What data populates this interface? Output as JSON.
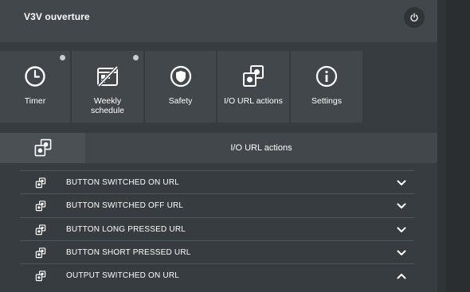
{
  "app": {
    "title": "V3V ouverture"
  },
  "tiles": [
    {
      "label": "Timer",
      "icon": "clock-icon",
      "has_dot": true
    },
    {
      "label": "Weekly\nschedule",
      "icon": "weekly-schedule-icon",
      "has_dot": true
    },
    {
      "label": "Safety",
      "icon": "shield-icon",
      "has_dot": false
    },
    {
      "label": "I/O URL actions",
      "icon": "io-url-icon",
      "has_dot": false
    },
    {
      "label": "Settings",
      "icon": "info-icon",
      "has_dot": false
    }
  ],
  "section": {
    "title": "I/O URL actions"
  },
  "rows": [
    {
      "label": "BUTTON SWITCHED ON URL",
      "expanded": false
    },
    {
      "label": "BUTTON SWITCHED OFF URL",
      "expanded": false
    },
    {
      "label": "BUTTON LONG PRESSED URL",
      "expanded": false
    },
    {
      "label": "BUTTON SHORT PRESSED URL",
      "expanded": false
    },
    {
      "label": "OUTPUT SWITCHED ON URL",
      "expanded": true
    }
  ],
  "colors": {
    "background": "#363c3f",
    "panel": "#41474a",
    "indicator_dot": "#c9cdcf"
  }
}
